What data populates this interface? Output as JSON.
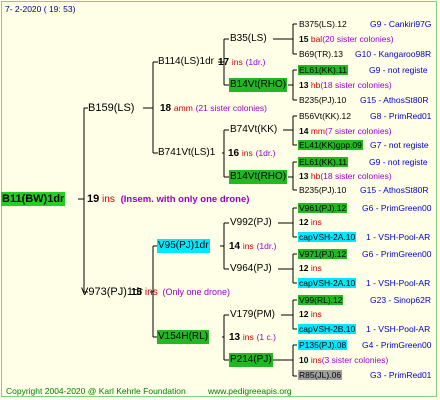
{
  "header": {
    "date": "7-  2-2020 ( 19: 53)"
  },
  "footer": {
    "copyright": "Copyright 2004-2020 @ Karl Kehrle Foundation",
    "website": "www.pedigreeapis.org"
  },
  "root": {
    "label": "B11(BW)1dr",
    "num": "19",
    "suffix": "ins",
    "note": "(Insem. with only one drone)"
  },
  "gen1": [
    {
      "label": "B159(LS)"
    },
    {
      "label": "V973(PJ)1dr",
      "num": "15",
      "suffix": "ins",
      "note": "(Only one drone)"
    }
  ],
  "gen2": [
    {
      "label": "B114(LS)1dr",
      "num": "17",
      "suffix": "ins",
      "note": "(1dr.)"
    },
    {
      "num": "18",
      "suffix": "amm",
      "note": "(21 sister colonies)"
    },
    {
      "label": "B741Vt(LS)1",
      "num": "16",
      "suffix": "ins",
      "note": "(1dr.)"
    },
    {
      "label": "V95(PJ)1dr",
      "num": "14",
      "suffix": "ins",
      "note": "(1dr.)"
    },
    {
      "label": "V154H(RL)",
      "num": "13",
      "suffix": "ins",
      "note": "(1 c.)"
    }
  ],
  "gen3": [
    {
      "label": "B35(LS)"
    },
    {
      "label": "B14Vt(RHO)"
    },
    {
      "label": "B74Vt(KK)"
    },
    {
      "label": "B14Vt(RHO)"
    },
    {
      "label": "V992(PJ)"
    },
    {
      "label": "V964(PJ)"
    },
    {
      "label": "V179(PM)"
    },
    {
      "label": "P214(PJ)"
    }
  ],
  "gen4": [
    {
      "label": "B375(LS).12",
      "info": "G9 - Cankiri97G"
    },
    {
      "num": "15",
      "suffix": "bal",
      "note": "(20 sister colonies)"
    },
    {
      "label": "B69(TR).13",
      "info": "G10 - Kangaroo98R"
    },
    {
      "label": "EL61(KK).11",
      "info": "G9 - not registe"
    },
    {
      "num": "13",
      "suffix": "hb",
      "note": "(18 sister colonies)"
    },
    {
      "label": "B235(PJ).10",
      "info": "G15 - AthosSt80R"
    },
    {
      "label": "B56Vt(KK).12",
      "info": "G8 - PrimRed01"
    },
    {
      "num": "14",
      "suffix": "mm",
      "note": "(7 sister colonies)"
    },
    {
      "label": "EL41(KK)gpp.09",
      "info": "G7 - not registe"
    },
    {
      "label": "EL61(KK).11",
      "info": "G9 - not registe"
    },
    {
      "num": "13",
      "suffix": "hb",
      "note": "(18 sister colonies)"
    },
    {
      "label": "B235(PJ).10",
      "info": "G15 - AthosSt80R"
    },
    {
      "label": "V961(PJ).12",
      "info": "G6 - PrimGreen00"
    },
    {
      "num": "12",
      "suffix": "ins"
    },
    {
      "label": "capVSH-2A.10",
      "info": "1 - VSH-Pool-AR"
    },
    {
      "label": "V971(PJ).12",
      "info": "G6 - PrimGreen00"
    },
    {
      "num": "12",
      "suffix": "ins"
    },
    {
      "label": "capVSH-2A.10",
      "info": "1 - VSH-Pool-AR"
    },
    {
      "label": "V99(RL).12",
      "info": "G23 - Sinop62R"
    },
    {
      "num": "12",
      "suffix": "ins"
    },
    {
      "label": "capVSH-2B.10",
      "info": "1 - VSH-Pool-AR"
    },
    {
      "label": "P135(PJ).08",
      "info": "G4 - PrimGreen00"
    },
    {
      "num": "10",
      "suffix": "ins",
      "note": "(3 sister colonies)"
    },
    {
      "label": "R85(JL).06",
      "info": "G3 - PrimRed01"
    }
  ]
}
